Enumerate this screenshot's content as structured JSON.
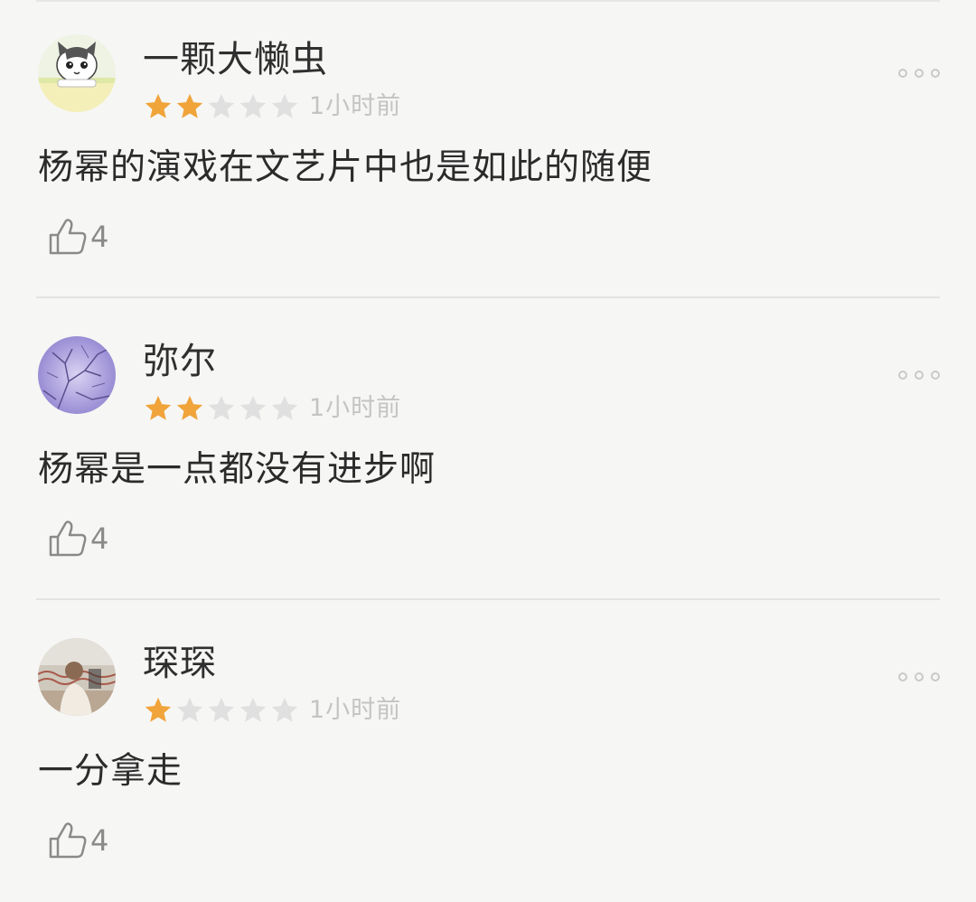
{
  "comments": [
    {
      "avatar": "cat-avatar",
      "username": "一颗大懒虫",
      "rating": 2,
      "max_rating": 5,
      "time": "1小时前",
      "text": "杨幂的演戏在文艺片中也是如此的随便",
      "likes": "4"
    },
    {
      "avatar": "tree-branches-avatar",
      "username": "弥尔",
      "rating": 2,
      "max_rating": 5,
      "time": "1小时前",
      "text": "杨幂是一点都没有进步啊",
      "likes": "4"
    },
    {
      "avatar": "person-photo-avatar",
      "username": "琛琛",
      "rating": 1,
      "max_rating": 5,
      "time": "1小时前",
      "text": "一分拿走",
      "likes": "4"
    }
  ],
  "colors": {
    "star_filled": "#f0a43a",
    "star_empty": "#e0e0e0",
    "background": "#f6f6f4",
    "text": "#2b2b2b",
    "muted": "#c4c4c4"
  },
  "icons": {
    "more": "ellipsis-icon",
    "like": "thumbs-up-icon",
    "star": "star-icon"
  }
}
